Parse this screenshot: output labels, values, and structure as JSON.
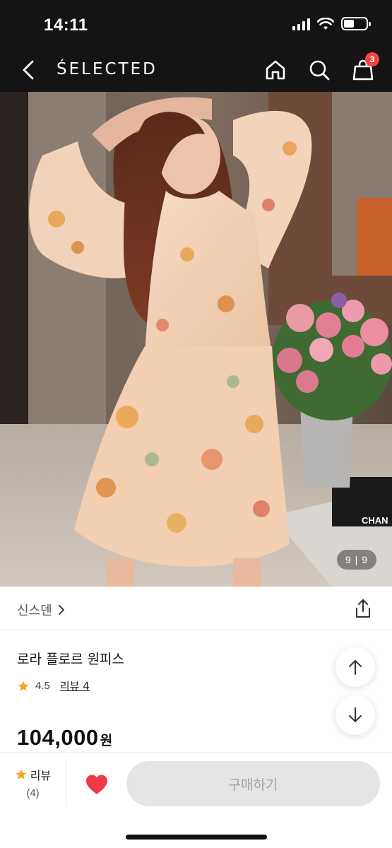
{
  "status_bar": {
    "time": "14:11"
  },
  "nav": {
    "brand": "ŚELECTED",
    "cart_count": "3"
  },
  "product": {
    "image_counter": "9 | 9",
    "image_text": "CHAN",
    "brand_name": "신스덴",
    "title": "로라 플로르 원피스",
    "rating": "4.5",
    "review_link": "리뷰 4",
    "price": "104,000",
    "price_unit": "원"
  },
  "bottom_bar": {
    "review_label": "리뷰",
    "review_count": "(4)",
    "buy_label": "구매하기"
  },
  "colors": {
    "header_bg": "#141414",
    "badge": "#f2453d",
    "star": "#f5a623",
    "heart": "#f03a47",
    "buy_button_bg": "#e5e5e5"
  }
}
